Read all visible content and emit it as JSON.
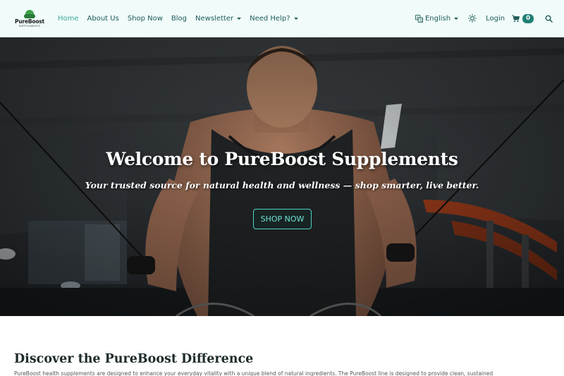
{
  "brand": {
    "name": "PureBoost",
    "tagline": "SUPPLEMENTS"
  },
  "nav": {
    "items": [
      {
        "label": "Home",
        "active": true
      },
      {
        "label": "About Us"
      },
      {
        "label": "Shop Now"
      },
      {
        "label": "Blog"
      },
      {
        "label": "Newsletter",
        "dropdown": true
      },
      {
        "label": "Need Help?",
        "dropdown": true
      }
    ],
    "language": "English",
    "login": "Login",
    "cart_count": "0"
  },
  "hero": {
    "title": "Welcome to PureBoost Supplements",
    "subtitle": "Your trusted source for natural health and wellness — shop smarter, live better.",
    "cta": "SHOP NOW"
  },
  "section": {
    "title": "Discover the PureBoost Difference",
    "text": "PureBoost health supplements are designed to enhance your everyday vitality with a unique blend of natural ingredients. The PureBoost line is designed to provide clean, sustained"
  },
  "icons": {
    "language": "translate-icon",
    "theme": "sun-icon",
    "cart": "cart-icon",
    "search": "search-icon"
  },
  "colors": {
    "navbar_bg": "#f0fbfa",
    "nav_link": "#1e5d57",
    "nav_active": "#3aa89b",
    "accent": "#4fd1c2",
    "badge": "#1f7f74"
  }
}
